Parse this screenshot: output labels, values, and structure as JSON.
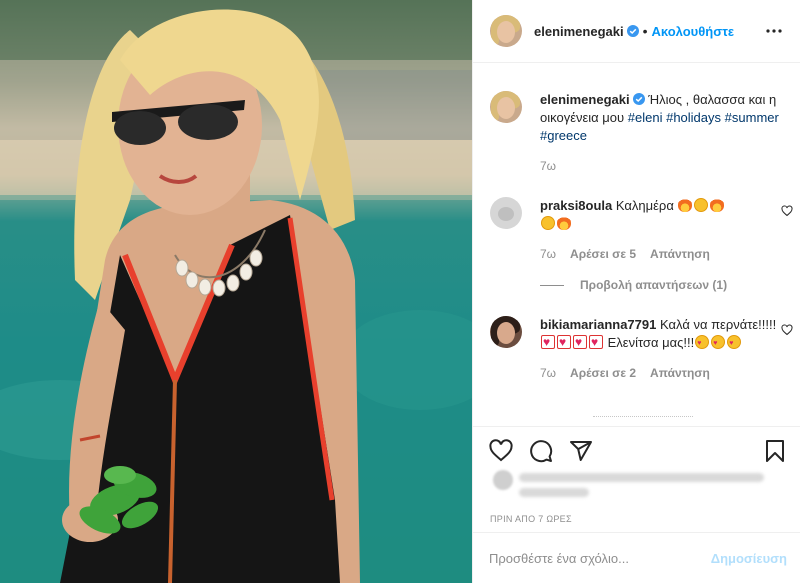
{
  "post": {
    "username": "elenimenegaki",
    "follow_label": "Ακολουθήστε",
    "dot": "•"
  },
  "caption": {
    "username": "elenimenegaki",
    "text": "Ήλιος , θαλασσα και η οικογένεια μου",
    "hashtags": [
      "#eleni",
      "#holidays",
      "#summer",
      "#greece"
    ],
    "time": "7ω"
  },
  "comments": [
    {
      "username": "praksi8oula",
      "text": "Καλημέρα",
      "emojis_line1": [
        "fire",
        "smile",
        "fire"
      ],
      "emojis_line2": [
        "smile",
        "fire"
      ],
      "time": "7ω",
      "likes": "Αρέσει σε 5",
      "reply_label": "Απάντηση",
      "view_replies": "Προβολή απαντήσεων (1)"
    },
    {
      "username": "bikiamarianna7791",
      "text_part1": "Καλά να περνάτε!!!!!",
      "text_part2": "Ελενίτσα μας!!!",
      "time": "7ω",
      "likes": "Αρέσει σε 2",
      "reply_label": "Απάντηση"
    }
  ],
  "time_ago": "ΠΡΙΝ ΑΠΟ 7 ΩΡΕΣ",
  "add_comment": {
    "placeholder": "Προσθέστε ένα σχόλιο...",
    "post_label": "Δημοσίευση"
  },
  "colors": {
    "link_blue": "#0095f6",
    "hashtag": "#00376b",
    "muted": "#8e8e8e",
    "post_disabled": "#b2dffc"
  },
  "icons": [
    "verified-badge-icon",
    "more-options-icon",
    "heart-icon",
    "comment-icon",
    "share-icon",
    "bookmark-icon",
    "small-heart-icon"
  ]
}
